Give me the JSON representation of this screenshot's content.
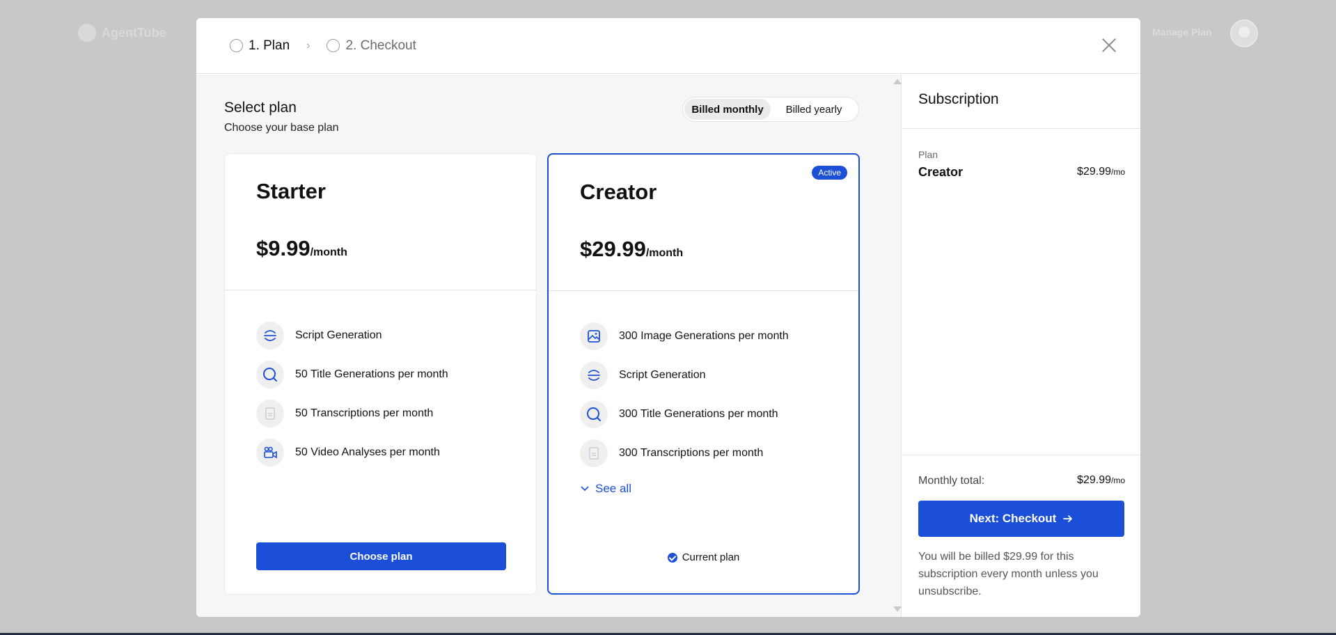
{
  "background": {
    "logo_text": "AgentTube",
    "manage_plan": "Manage Plan"
  },
  "steps": [
    {
      "label": "1. Plan",
      "active": true
    },
    {
      "label": "2. Checkout",
      "active": false
    }
  ],
  "step_separator": "›",
  "plan_section": {
    "title": "Select plan",
    "subtitle": "Choose your base plan",
    "billing": {
      "monthly": "Billed monthly",
      "yearly": "Billed yearly",
      "selected": "monthly"
    }
  },
  "plans": [
    {
      "name": "Starter",
      "price": "$9.99",
      "period": "/month",
      "features": [
        {
          "icon": "script-icon",
          "text": "Script Generation"
        },
        {
          "icon": "search-icon",
          "text": "50 Title Generations per month"
        },
        {
          "icon": "document-icon",
          "text": "50 Transcriptions per month"
        },
        {
          "icon": "video-camera-icon",
          "text": "50 Video Analyses per month"
        }
      ],
      "cta": "Choose plan"
    },
    {
      "name": "Creator",
      "price": "$29.99",
      "period": "/month",
      "badge": "Active",
      "features": [
        {
          "icon": "image-icon",
          "text": "300 Image Generations per month"
        },
        {
          "icon": "script-icon",
          "text": "Script Generation"
        },
        {
          "icon": "search-icon",
          "text": "300 Title Generations per month"
        },
        {
          "icon": "document-icon",
          "text": "300 Transcriptions per month"
        }
      ],
      "see_all": "See all",
      "current_label": "Current plan"
    }
  ],
  "subscription": {
    "title": "Subscription",
    "plan_label": "Plan",
    "plan_name": "Creator",
    "plan_price": "$29.99",
    "plan_unit": "/mo",
    "total_label": "Monthly total:",
    "total_price": "$29.99",
    "total_unit": "/mo",
    "next_button": "Next: Checkout",
    "note": "You will be billed $29.99 for this subscription every month unless you unsubscribe."
  },
  "colors": {
    "accent": "#1c4fd8",
    "overlay": "#c8c8c8"
  }
}
